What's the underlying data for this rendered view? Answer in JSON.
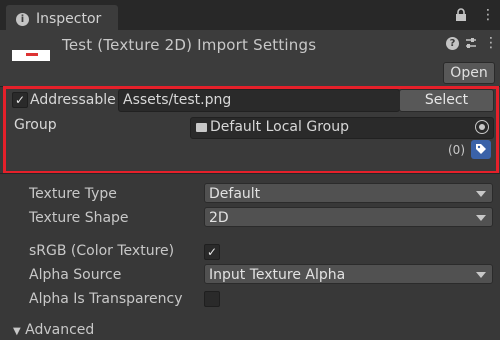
{
  "tab": {
    "title": "Inspector"
  },
  "header": {
    "title": "Test (Texture 2D) Import Settings",
    "open_label": "Open"
  },
  "addressable": {
    "label": "Addressable",
    "checked": true,
    "checkmark": "✓",
    "path": "Assets/test.png",
    "select_label": "Select",
    "group_label": "Group",
    "group_value": "Default Local Group",
    "labels_count": "(0)",
    "label_icon": "tag-icon"
  },
  "properties": {
    "texture_type": {
      "label": "Texture Type",
      "value": "Default"
    },
    "texture_shape": {
      "label": "Texture Shape",
      "value": "2D"
    },
    "srgb": {
      "label": "sRGB (Color Texture)",
      "checked": true,
      "checkmark": "✓"
    },
    "alpha_source": {
      "label": "Alpha Source",
      "value": "Input Texture Alpha"
    },
    "alpha_transparency": {
      "label": "Alpha Is Transparency",
      "checked": false
    }
  },
  "advanced": {
    "label": "Advanced"
  },
  "colors": {
    "highlight_border": "#e5202a",
    "label_button": "#3a62a8",
    "background": "#383838"
  }
}
